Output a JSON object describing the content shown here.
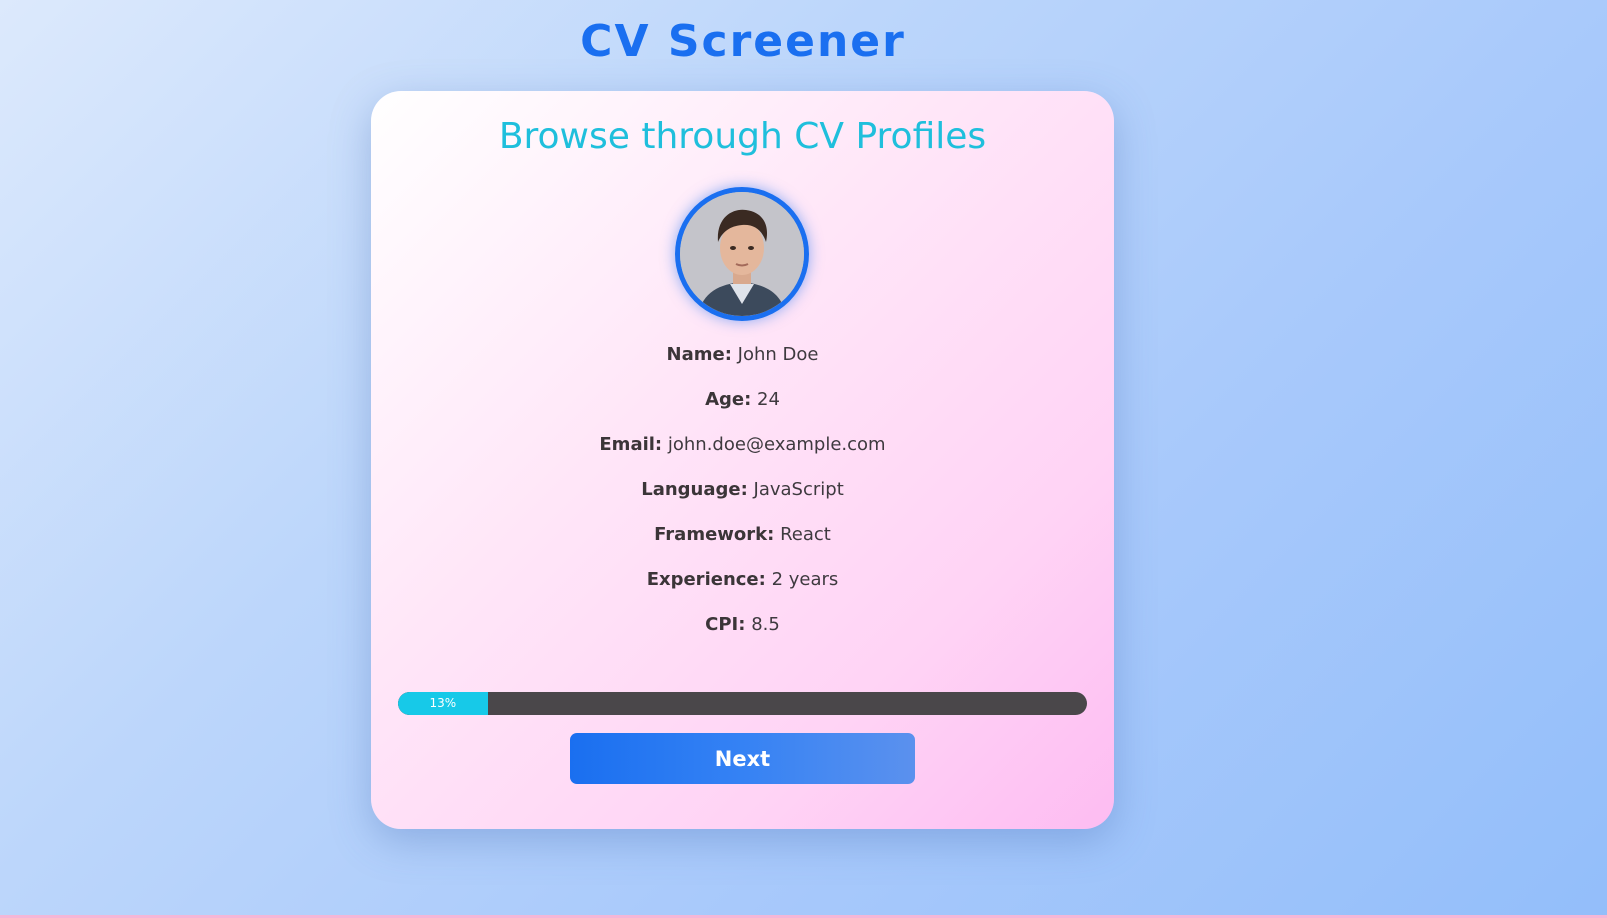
{
  "app_title": "CV Screener",
  "card": {
    "heading": "Browse through CV Profiles",
    "avatar_icon": "person-portrait"
  },
  "profile": {
    "fields": [
      {
        "label": "Name:",
        "value": "John Doe"
      },
      {
        "label": "Age:",
        "value": "24"
      },
      {
        "label": "Email:",
        "value": "john.doe@example.com"
      },
      {
        "label": "Language:",
        "value": "JavaScript"
      },
      {
        "label": "Framework:",
        "value": "React"
      },
      {
        "label": "Experience:",
        "value": "2 years"
      },
      {
        "label": "CPI:",
        "value": "8.5"
      }
    ]
  },
  "progress": {
    "value": 0.13,
    "label": "13%"
  },
  "next_label": "Next",
  "colors": {
    "title": "#1a6ff0",
    "heading": "#1fbfdc",
    "progress_fill": "#17c9e8",
    "progress_track": "#4a474a",
    "button": "#1a6ff0"
  }
}
